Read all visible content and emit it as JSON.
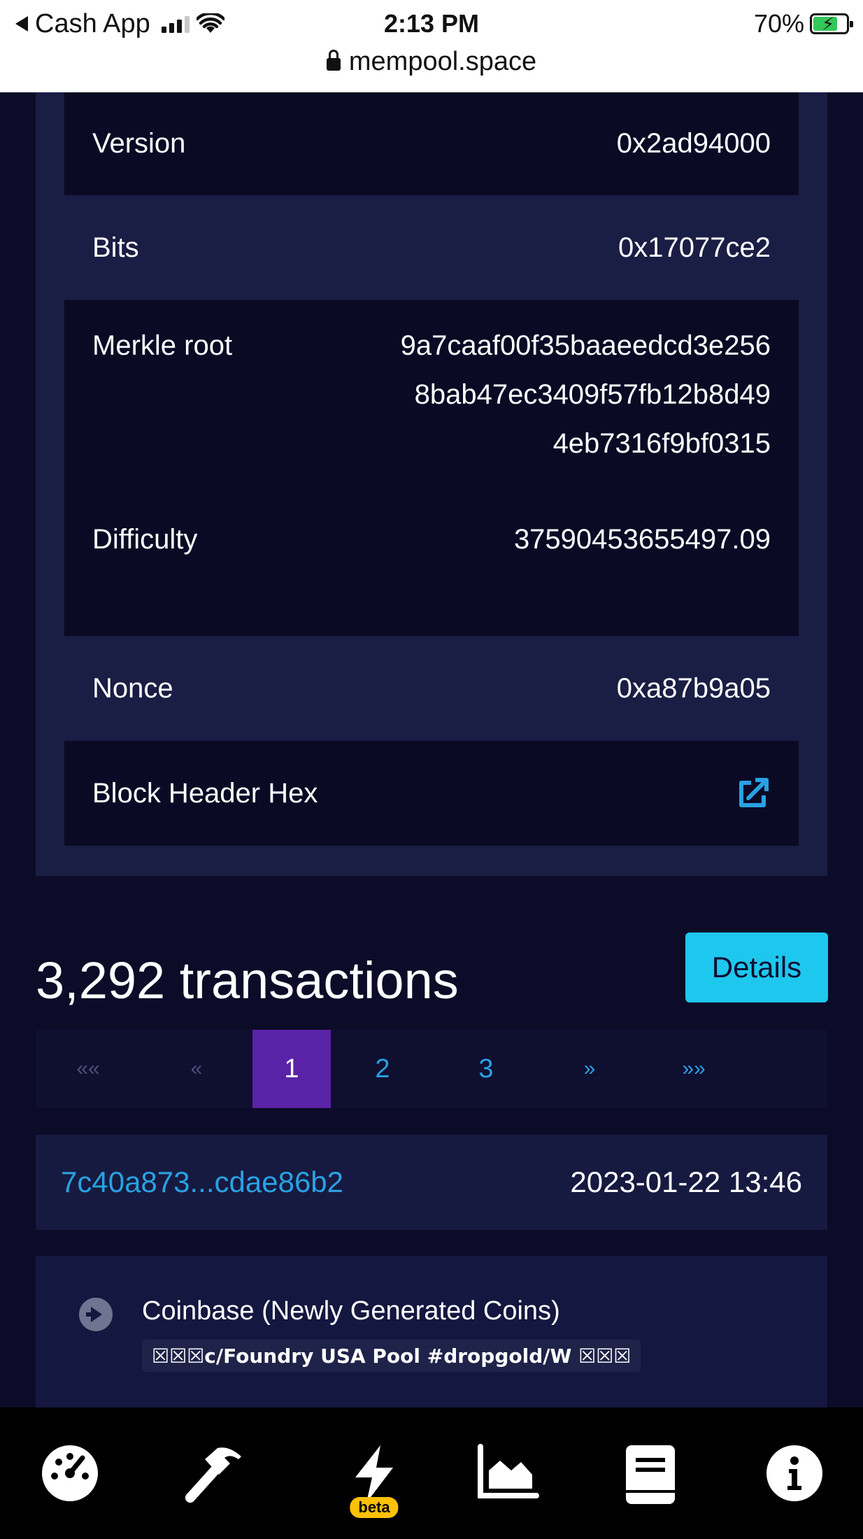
{
  "status_bar": {
    "back_app": "Cash App",
    "time": "2:13 PM",
    "battery": "70%",
    "url": "mempool.space"
  },
  "block_details": {
    "version_label": "Version",
    "version_value": "0x2ad94000",
    "bits_label": "Bits",
    "bits_value": "0x17077ce2",
    "merkle_label": "Merkle root",
    "merkle_line1": "9a7caaf00f35baaeedcd3e256",
    "merkle_line2": "8bab47ec3409f57fb12b8d49",
    "merkle_line3": "4eb7316f9bf0315",
    "difficulty_label": "Difficulty",
    "difficulty_value": "37590453655497.09",
    "nonce_label": "Nonce",
    "nonce_value": "0xa87b9a05",
    "header_hex_label": "Block Header Hex"
  },
  "transactions": {
    "title": "3,292 transactions",
    "details_button": "Details",
    "pagination": {
      "first": "««",
      "prev": "«",
      "pages": [
        "1",
        "2",
        "3"
      ],
      "next": "»",
      "last": "»»"
    },
    "tx_id": "7c40a873...cdae86b2",
    "tx_time": "2023-01-22 13:46",
    "coinbase_title": "Coinbase (Newly Generated Coins)",
    "coinbase_script": "☒☒☒c/Foundry USA Pool #dropgold/W ☒☒☒"
  },
  "bottom_nav": {
    "beta_badge": "beta"
  },
  "colors": {
    "accent": "#1ec7ee",
    "link": "#2aa1e2",
    "active_page": "#5a23a7",
    "beta": "#ffc107"
  }
}
